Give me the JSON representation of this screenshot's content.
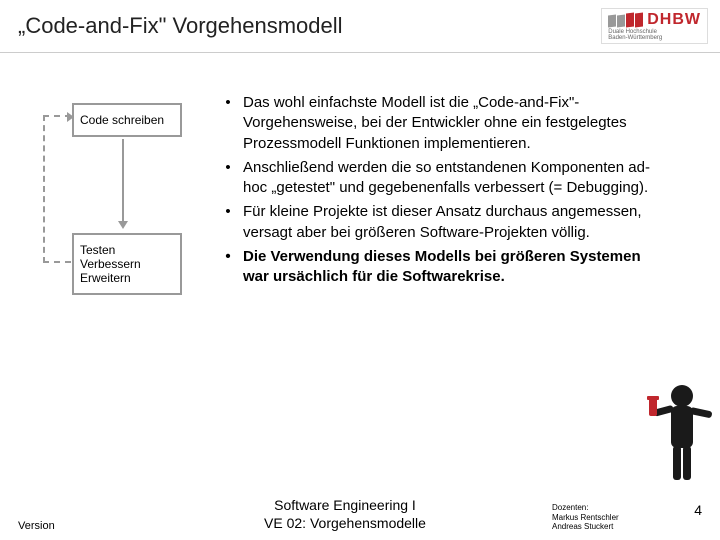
{
  "header": {
    "title": "„Code-and-Fix\" Vorgehensmodell",
    "logo_text": "DHBW",
    "logo_sub1": "Duale Hochschule",
    "logo_sub2": "Baden-Württemberg"
  },
  "diagram": {
    "box_top": "Code schreiben",
    "box_bottom_l1": "Testen",
    "box_bottom_l2": "Verbessern",
    "box_bottom_l3": "Erweitern"
  },
  "bullets": [
    {
      "text": "Das wohl einfachste Modell ist die „Code-and-Fix\"-Vorgehensweise, bei der Entwickler ohne ein festgelegtes Prozessmodell Funktionen implementieren.",
      "bold": false
    },
    {
      "text": "Anschließend werden die so entstandenen Komponenten ad-hoc „getestet\" und gegebenenfalls verbessert (= Debugging).",
      "bold": false
    },
    {
      "text": "Für kleine Projekte ist dieser Ansatz durchaus angemessen, versagt aber bei größeren Software-Projekten völlig.",
      "bold": false
    },
    {
      "text": "Die Verwendung dieses Modells bei größeren Systemen war ursächlich für die Softwarekrise.",
      "bold": true
    }
  ],
  "footer": {
    "left": "Version",
    "center_l1": "Software Engineering I",
    "center_l2": "VE 02: Vorgehensmodelle",
    "right_l1": "Dozenten:",
    "right_l2": "Markus Rentschler",
    "right_l3": "Andreas Stuckert",
    "page": "4"
  }
}
